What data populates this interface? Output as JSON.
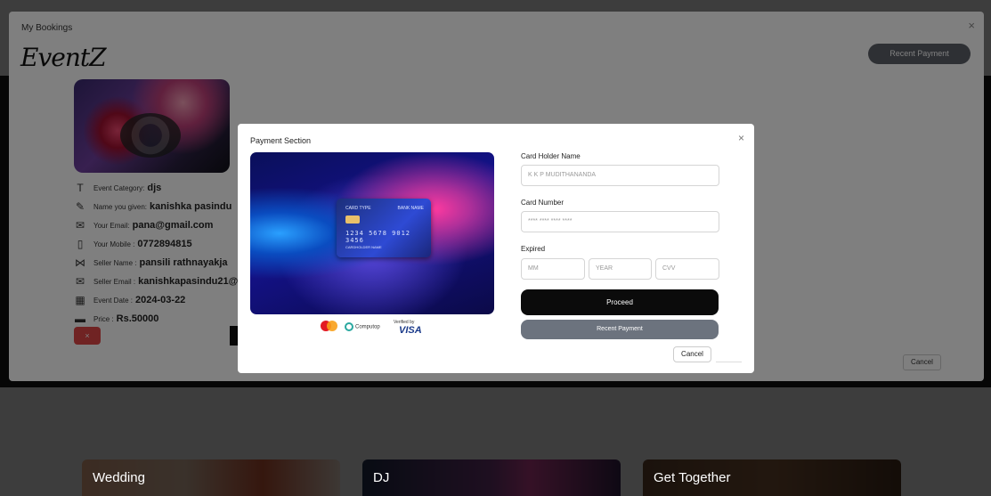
{
  "background": {
    "cards": [
      {
        "label": "Wedding"
      },
      {
        "label": "DJ"
      },
      {
        "label": "Get Together"
      }
    ]
  },
  "bookings_modal": {
    "title": "My Bookings",
    "close_icon": "×",
    "brand": "EventZ",
    "recent_payment_label": "Recent Payment",
    "image_icon": "dj-headphones-image",
    "details": [
      {
        "icon": "T",
        "label": "Event Category:",
        "value": "djs"
      },
      {
        "icon": "✎",
        "label": "Name you given:",
        "value": "kanishka pasindu"
      },
      {
        "icon": "✉",
        "label": "Your Email:",
        "value": "pana@gmail.com"
      },
      {
        "icon": "▯",
        "label": "Your Mobile :",
        "value": "0772894815"
      },
      {
        "icon": "⋈",
        "label": "Seller Name :",
        "value": "pansili rathnayakja"
      },
      {
        "icon": "✉",
        "label": "Seller Email :",
        "value": "kanishkapasindu21@g"
      },
      {
        "icon": "▦",
        "label": "Event Date :",
        "value": "2024-03-22"
      },
      {
        "icon": "▬",
        "label": "Price :",
        "value": "Rs.50000"
      }
    ],
    "delete_icon": "×",
    "cancel_label": "Cancel"
  },
  "payment_modal": {
    "title": "Payment Section",
    "close_icon": "×",
    "card_preview": {
      "type_label": "CARD TYPE",
      "bank_label": "BANK NAME",
      "number": "1234 5678 9012 3456",
      "holder_label": "CARDHOLDER NAME"
    },
    "logos": {
      "computop": "Computop",
      "verified_by": "Verified by",
      "visa": "VISA"
    },
    "holder": {
      "label": "Card Holder Name",
      "value": "K K P MUDITHANANDA"
    },
    "number": {
      "label": "Card Number",
      "placeholder": "**** **** **** ****"
    },
    "expired": {
      "label": "Expired",
      "mm": "MM",
      "year": "YEAR",
      "cvv": "CVV"
    },
    "proceed_label": "Proceed",
    "recent_payment_label": "Recent Payment",
    "cancel_label": "Cancel"
  }
}
